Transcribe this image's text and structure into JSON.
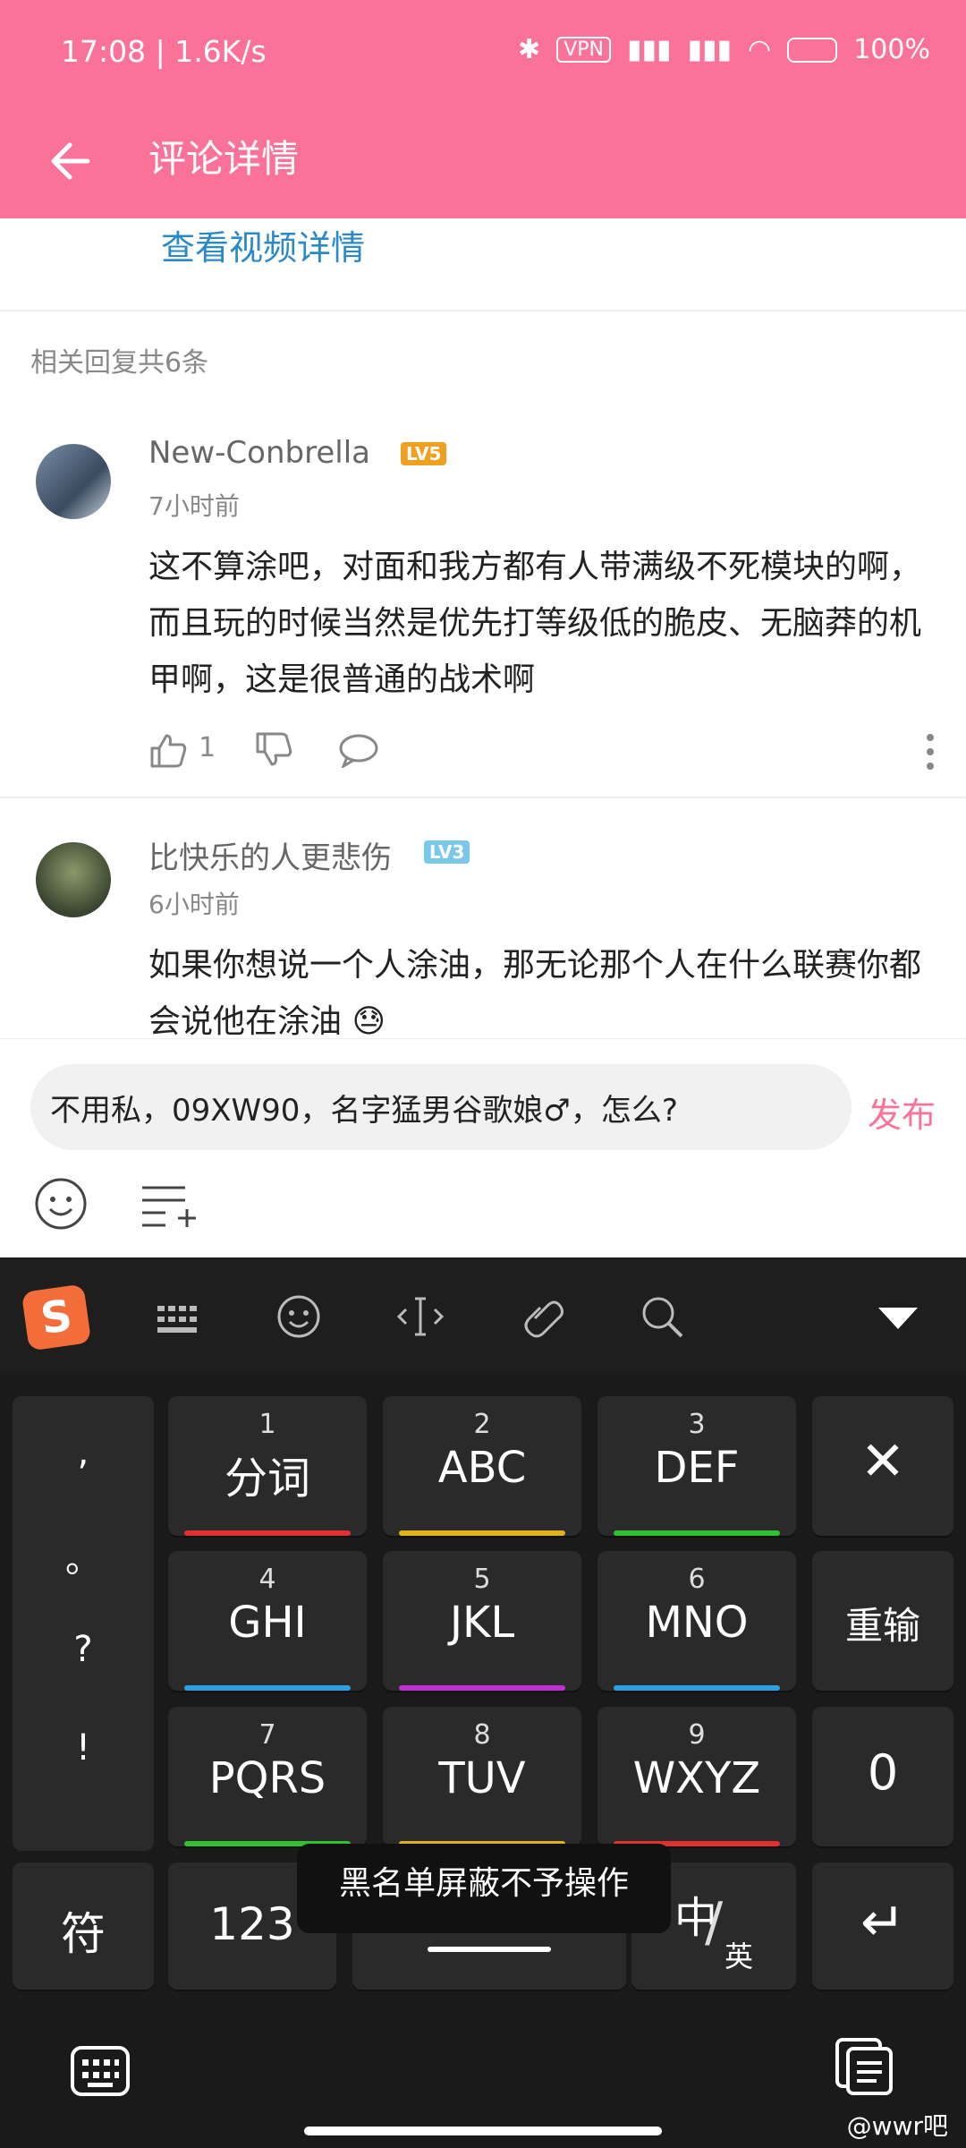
{
  "status": {
    "time_speed": "17:08 | 1.6K/s",
    "vpn": "VPN",
    "battery": "100%"
  },
  "header": {
    "title": "评论详情"
  },
  "video_link": "查看视频详情",
  "replies_count": "相关回复共6条",
  "comments": [
    {
      "username": "New-Conbrella",
      "level": "LV5",
      "level_color": "#f0a020",
      "time": "7小时前",
      "content": "这不算涂吧，对面和我方都有人带满级不死模块的啊，而且玩的时候当然是优先打等级低的脆皮、无脑莽的机甲啊，这是很普通的战术啊",
      "likes": "1"
    },
    {
      "username": "比快乐的人更悲伤",
      "level": "LV3",
      "level_color": "#7ac8e8",
      "time": "6小时前",
      "content": "如果你想说一个人涂油，那无论那个人在什么联赛你都会说他在涂油 😓"
    }
  ],
  "input": {
    "value": "不用私，09XW90，名字猛男谷歌娘♂，怎么?",
    "publish_label": "发布"
  },
  "keyboard": {
    "punct": [
      ",",
      "。",
      "?",
      "!"
    ],
    "keys": [
      {
        "num": "1",
        "label": "分词",
        "color": "#e03030"
      },
      {
        "num": "2",
        "label": "ABC",
        "color": "#e0b020"
      },
      {
        "num": "3",
        "label": "DEF",
        "color": "#30c030"
      },
      {
        "num": "4",
        "label": "GHI",
        "color": "#2aa0e0"
      },
      {
        "num": "5",
        "label": "JKL",
        "color": "#c030d0"
      },
      {
        "num": "6",
        "label": "MNO",
        "color": "#2aa0e0"
      },
      {
        "num": "7",
        "label": "PQRS",
        "color": "#30c030"
      },
      {
        "num": "8",
        "label": "TUV",
        "color": "#e0b020"
      },
      {
        "num": "9",
        "label": "WXYZ",
        "color": "#e03030"
      }
    ],
    "delete_label": "✕",
    "retype_label": "重输",
    "zero_label": "0",
    "symbol_label": "符",
    "num_label": "123",
    "lang_label_zh": "中",
    "lang_label_en": "英",
    "enter_label": "↵"
  },
  "toast": "黑名单屏蔽不予操作",
  "watermark": "@wwr吧",
  "colors": {
    "accent": "#fb7299",
    "link": "#2a8ac8"
  }
}
